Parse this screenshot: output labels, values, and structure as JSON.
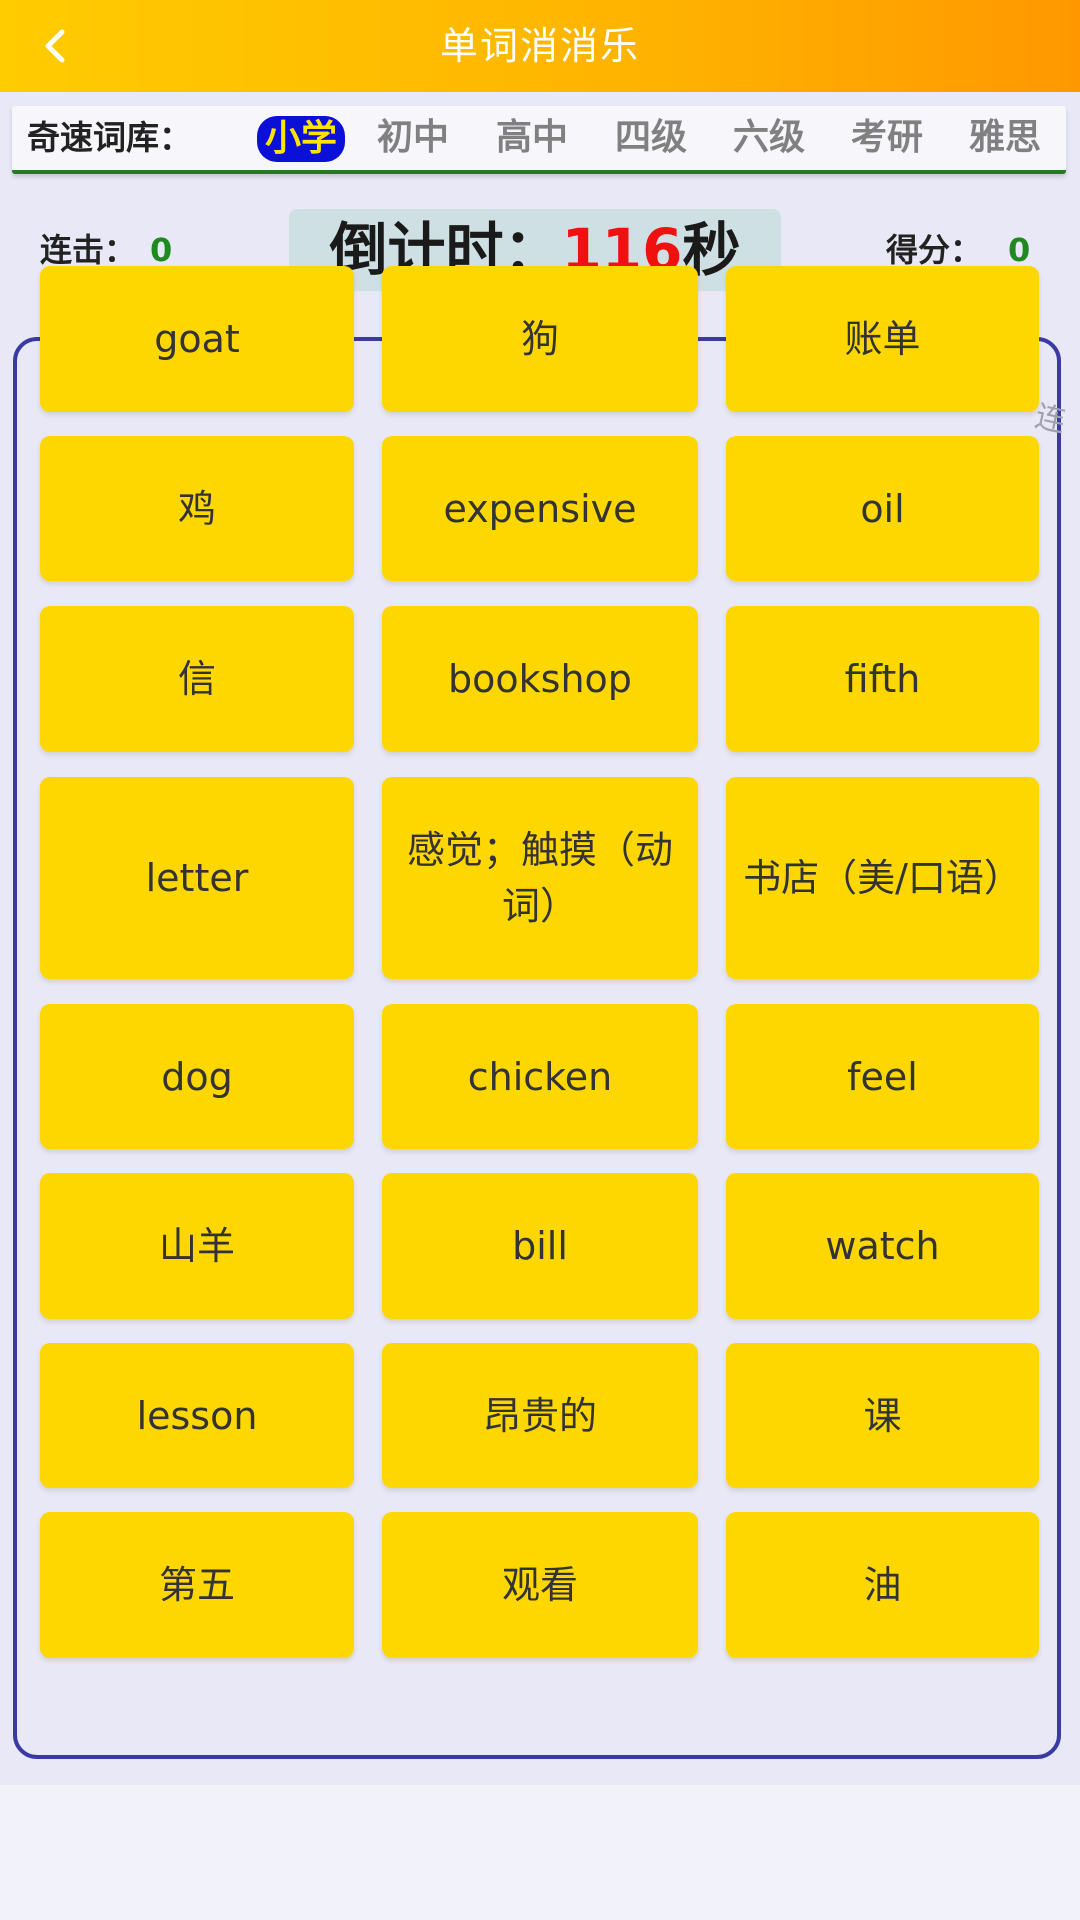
{
  "header": {
    "title": "单词消消乐",
    "back_icon": "chevron-left-icon"
  },
  "category": {
    "label": "奇速词库：",
    "options": [
      "小学",
      "初中",
      "高中",
      "四级",
      "六级",
      "考研",
      "雅思"
    ],
    "selected": "小学"
  },
  "stats": {
    "combo_label": "连击：",
    "combo_value": "0",
    "countdown_label": "倒计时：",
    "countdown_value": "116",
    "countdown_unit": "秒",
    "score_label": "得分：",
    "score_value": "0"
  },
  "cards": [
    "goat",
    "狗",
    "账单",
    "鸡",
    "expensive",
    "oil",
    "信",
    "bookshop",
    "fifth",
    "letter",
    "感觉；触摸（动词）",
    "书店（美/口语）",
    "dog",
    "chicken",
    "feel",
    "山羊",
    "bill",
    "watch",
    "lesson",
    "昂贵的",
    "课",
    "第五",
    "观看",
    "油"
  ],
  "colors": {
    "header_start": "#ffcc00",
    "header_end": "#ff9800",
    "card": "#ffd700",
    "board_border": "#3a3aa5",
    "active_tab_bg": "#0b10d8",
    "active_tab_text": "#ffe400",
    "countdown_number": "#f01010",
    "stat_value": "#1f8a1f"
  }
}
